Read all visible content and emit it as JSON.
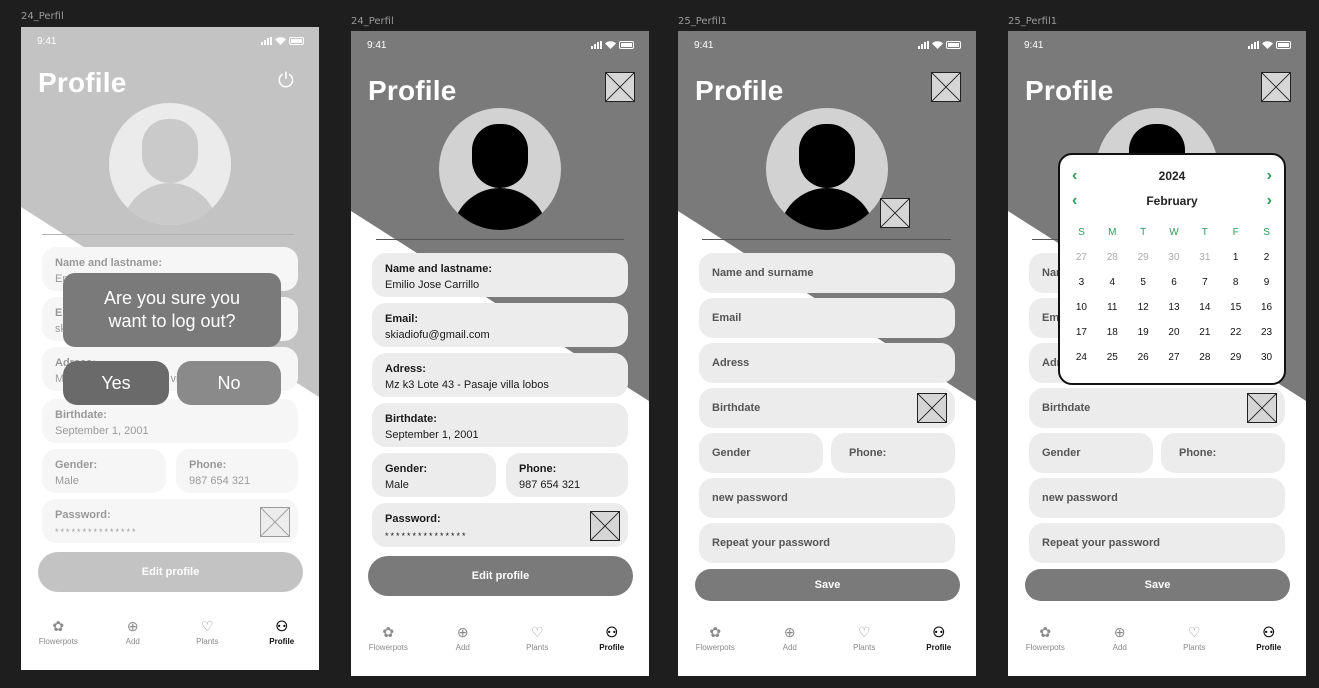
{
  "frames": [
    {
      "label": "24_Perfil"
    },
    {
      "label": "24_Perfil"
    },
    {
      "label": "25_Perfil1"
    },
    {
      "label": "25_Perfil1"
    }
  ],
  "status": {
    "time": "9:41"
  },
  "profile": {
    "title": "Profile",
    "fields": {
      "name_label": "Name and lastname:",
      "name_value": "Emilio Jose Carrillo",
      "email_label": "Email:",
      "email_value": "skiadiofu@gmail.com",
      "address_label": "Adress:",
      "address_value": "Mz k3 Lote 43 - Pasaje villa lobos",
      "birth_label": "Birthdate:",
      "birth_value": "September 1, 2001",
      "gender_label": "Gender:",
      "gender_value": "Male",
      "phone_label": "Phone:",
      "phone_value": "987 654 321",
      "password_label": "Password:",
      "password_value": "***************"
    },
    "edit_button": "Edit profile"
  },
  "logout_dialog": {
    "question": "Are you sure you want to log out?",
    "yes": "Yes",
    "no": "No"
  },
  "edit_form": {
    "name_placeholder": "Name and surname",
    "email_placeholder": "Email",
    "address_placeholder": "Adress",
    "birth_placeholder": "Birthdate",
    "gender_placeholder": "Gender",
    "phone_placeholder": "Phone:",
    "new_password_placeholder": "new password",
    "repeat_password_placeholder": "Repeat your password",
    "save_button": "Save"
  },
  "tabs": [
    {
      "label": "Flowerpots",
      "icon": "plant-icon"
    },
    {
      "label": "Add",
      "icon": "add-icon"
    },
    {
      "label": "Plants",
      "icon": "heart-icon"
    },
    {
      "label": "Profile",
      "icon": "user-icon"
    }
  ],
  "calendar": {
    "year": "2024",
    "month": "February",
    "weekdays": [
      "S",
      "M",
      "T",
      "W",
      "T",
      "F",
      "S"
    ],
    "days": [
      "27",
      "28",
      "29",
      "30",
      "31",
      "1",
      "2",
      "3",
      "4",
      "5",
      "6",
      "7",
      "8",
      "9",
      "10",
      "11",
      "12",
      "13",
      "14",
      "15",
      "16",
      "17",
      "18",
      "19",
      "20",
      "21",
      "22",
      "23",
      "24",
      "25",
      "26",
      "27",
      "28",
      "29",
      "30"
    ],
    "muted_count": 5
  },
  "colors": {
    "header_gray": "#7a7a7a",
    "field_bg": "#ececec",
    "calendar_accent": "#2a9d5a"
  }
}
